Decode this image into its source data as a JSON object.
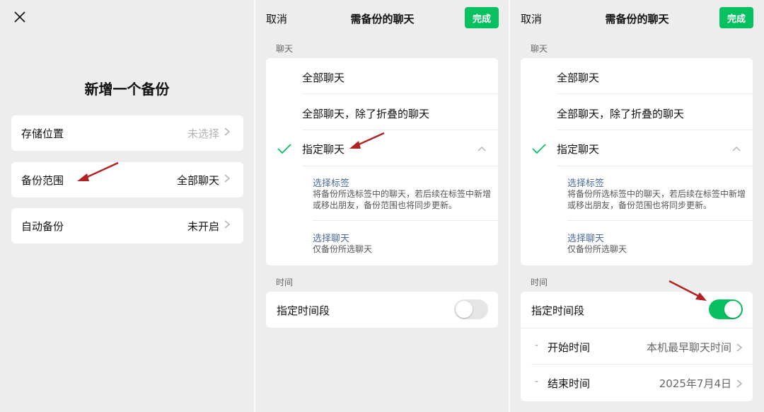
{
  "colors": {
    "accent": "#07c160",
    "link": "#4a6a9a",
    "arrow": "#b22222"
  },
  "panel1": {
    "close_icon": "close-icon",
    "title": "新增一个备份",
    "rows": [
      {
        "label": "存储位置",
        "value": "未选择"
      },
      {
        "label": "备份范围",
        "value": "全部聊天"
      },
      {
        "label": "自动备份",
        "value": "未开启"
      }
    ]
  },
  "chat_panel": {
    "cancel": "取消",
    "title": "需备份的聊天",
    "done": "完成",
    "section_chats": "聊天",
    "options": [
      "全部聊天",
      "全部聊天，除了折叠的聊天",
      "指定聊天"
    ],
    "select_tags": {
      "title": "选择标签",
      "desc": "将备份所选标签中的聊天，若后续在标签中新增或移出朋友，备份范围也将同步更新。"
    },
    "select_chats": {
      "title": "选择聊天",
      "desc": "仅备份所选聊天"
    },
    "section_time": "时间",
    "time_range_label": "指定时间段"
  },
  "panel2": {
    "time_range_on": false
  },
  "panel3": {
    "time_range_on": true,
    "start_label": "开始时间",
    "start_value": "本机最早聊天时间",
    "end_label": "结束时间",
    "end_value": "2025年7月4日"
  }
}
